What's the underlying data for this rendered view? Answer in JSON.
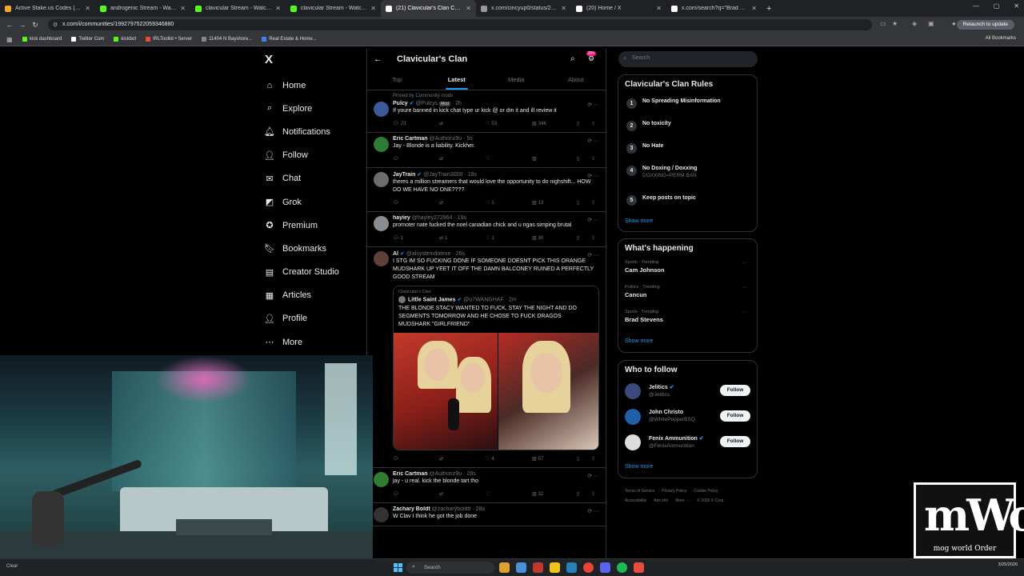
{
  "browser": {
    "tabs": [
      {
        "title": "Active Stake.us Codes (Update",
        "color": "#f5a623",
        "active": false
      },
      {
        "title": "androgenic Stream - Watch Liv",
        "color": "#53fc18",
        "active": false
      },
      {
        "title": "clavicular Stream - Watch Live",
        "color": "#53fc18",
        "active": false
      },
      {
        "title": "clavicular Stream - Watch Live",
        "color": "#53fc18",
        "active": false
      },
      {
        "title": "(21) Clavicular's Clan Commun",
        "color": "#ffffff",
        "active": true
      },
      {
        "title": "x.com/cincyup0/status/20366",
        "color": "#999999",
        "active": false
      },
      {
        "title": "(20) Home / X",
        "color": "#ffffff",
        "active": false
      },
      {
        "title": "x.com/search?q=\"Brad Steven",
        "color": "#ffffff",
        "active": false
      }
    ],
    "url": "x.com/i/communities/1992797522059346880",
    "relaunch_label": "Relaunch to update",
    "bookmarks": [
      {
        "label": "kick dashboard",
        "color": "#53fc18"
      },
      {
        "label": "Twitter Com",
        "color": "#ffffff"
      },
      {
        "label": "kickbot",
        "color": "#53fc18"
      },
      {
        "label": "IRLToolkit • Server",
        "color": "#e74c3c"
      },
      {
        "label": "11404 N Bayshore...",
        "color": "#888888"
      },
      {
        "label": "Real Estate & Home...",
        "color": "#3b82f6"
      }
    ],
    "all_bookmarks": "All Bookmarks"
  },
  "nav": {
    "logo": "X",
    "items": [
      {
        "label": "Home",
        "icon": "⌂"
      },
      {
        "label": "Explore",
        "icon": "⌕"
      },
      {
        "label": "Notifications",
        "icon": "🔔︎",
        "badge": "20+"
      },
      {
        "label": "Follow",
        "icon": "👤︎"
      },
      {
        "label": "Chat",
        "icon": "✉"
      },
      {
        "label": "Grok",
        "icon": "◩"
      },
      {
        "label": "Premium",
        "icon": "✪"
      },
      {
        "label": "Bookmarks",
        "icon": "🔖︎"
      },
      {
        "label": "Creator Studio",
        "icon": "▤"
      },
      {
        "label": "Articles",
        "icon": "▦"
      },
      {
        "label": "Profile",
        "icon": "👤︎"
      },
      {
        "label": "More",
        "icon": "⋯"
      }
    ]
  },
  "feed": {
    "title": "Clavicular's Clan",
    "badge": "20+",
    "tabs": [
      "Top",
      "Latest",
      "Media",
      "About"
    ],
    "active_tab": "Latest",
    "posts": [
      {
        "pinned": "Pinned by Community mods",
        "name": "Pulcy",
        "handle": "@Pulcys",
        "mod": "Mod",
        "time": "2h",
        "verified": true,
        "text": "If youre banned in kick chat type ur kick @ or dm it and ill review it",
        "avatar": "#3b5998",
        "replies": "23",
        "reposts": "",
        "likes": "53",
        "views": "34K"
      },
      {
        "name": "Eric Cartman",
        "handle": "@Authoriz9u",
        "time": "5s",
        "verified": false,
        "text": "Jay - Blonde is a liability. Kickher.",
        "avatar": "#2e7d32",
        "replies": "",
        "reposts": "",
        "likes": "",
        "views": ""
      },
      {
        "name": "JayTrain",
        "handle": "@JayTrain3000",
        "time": "18s",
        "verified": true,
        "text": "theres a million streamers that would love the opportunity to do nighshift... HOW DO WE HAVE NO ONE????",
        "avatar": "#6d6d6d",
        "replies": "",
        "reposts": "",
        "likes": "1",
        "views": "13"
      },
      {
        "name": "hayley",
        "handle": "@hayley272964",
        "time": "19s",
        "verified": false,
        "text": "promoter nate fucked the noel canadian chick and u ngas simping brutal",
        "avatar": "#8a8d91",
        "replies": "1",
        "reposts": "1",
        "likes": "1",
        "views": "30"
      },
      {
        "name": "Al",
        "handle": "@alsystemdotexe",
        "time": "26s",
        "verified": true,
        "text": "I STG IM SO FUCKING DONE IF SOMEONE DOESNT PICK THIS ORANGE MUDSHARK UP YEET IT OFF THE DAMN BALCONEY RUINED A PERFECTLY GOOD STREAM",
        "avatar": "#5d4037",
        "quote": {
          "community": "Clavicular's Clan",
          "name": "Little Saint James",
          "handle": "@o7WANGHAF",
          "time": "2m",
          "text": "THE BLONDE STACY WANTED TO FUCK, STAY THE NIGHT AND DO SEGMENTS TOMORROW AND HE CHOSE TO FUCK DRAGOS MUDSHARK \"GIRLFRIEND\""
        },
        "replies": "",
        "reposts": "",
        "likes": "4",
        "views": "57"
      },
      {
        "name": "Eric Cartman",
        "handle": "@Authoriz9u",
        "time": "28s",
        "verified": false,
        "text": "jay - u real. kick the blonde tart tho",
        "avatar": "#2e7d32",
        "replies": "",
        "reposts": "",
        "likes": "",
        "views": "32"
      },
      {
        "name": "Zachary Boldt",
        "handle": "@zacharyboldtt",
        "time": "28s",
        "verified": false,
        "text": "W Clav I think he got the job done",
        "avatar": "#333333"
      }
    ]
  },
  "right": {
    "search_placeholder": "Search",
    "rules_title": "Clavicular's Clan Rules",
    "rules": [
      {
        "num": "1",
        "text": "No Spreading Misinformation",
        "sub": ""
      },
      {
        "num": "2",
        "text": "No toxicity",
        "sub": ""
      },
      {
        "num": "3",
        "text": "No Hate",
        "sub": ""
      },
      {
        "num": "4",
        "text": "No Doxing / Doxxing",
        "sub": "DOXXING=PERM BAN"
      },
      {
        "num": "5",
        "text": "Keep posts on topic",
        "sub": ""
      }
    ],
    "show_more": "Show more",
    "happening_title": "What's happening",
    "trends": [
      {
        "meta": "Sports · Trending",
        "name": "Cam Johnson"
      },
      {
        "meta": "Politics · Trending",
        "name": "Cancun"
      },
      {
        "meta": "Sports · Trending",
        "name": "Brad Stevens"
      }
    ],
    "wtf_title": "Who to follow",
    "who_to_follow": [
      {
        "name": "Jelitics",
        "handle": "@Jelitics",
        "color": "#3a4a7a",
        "verified": true
      },
      {
        "name": "John Christo",
        "handle": "@WhitePepperESQ",
        "color": "#1f5fa8",
        "verified": false
      },
      {
        "name": "Fenix Ammunition",
        "handle": "@FenixAmmunition",
        "color": "#dddddd",
        "verified": true
      }
    ],
    "follow_label": "Follow",
    "footer": [
      "Terms of Service",
      "Privacy Policy",
      "Cookie Policy",
      "Accessibility",
      "Ads info",
      "More ···",
      "© 2026 X Corp."
    ]
  },
  "overlay": {
    "logo_big": "mWo",
    "logo_small": "mog world Order"
  },
  "taskbar": {
    "weather": "Clear",
    "search_placeholder": "Search",
    "time": "",
    "date": "3/25/2026"
  }
}
